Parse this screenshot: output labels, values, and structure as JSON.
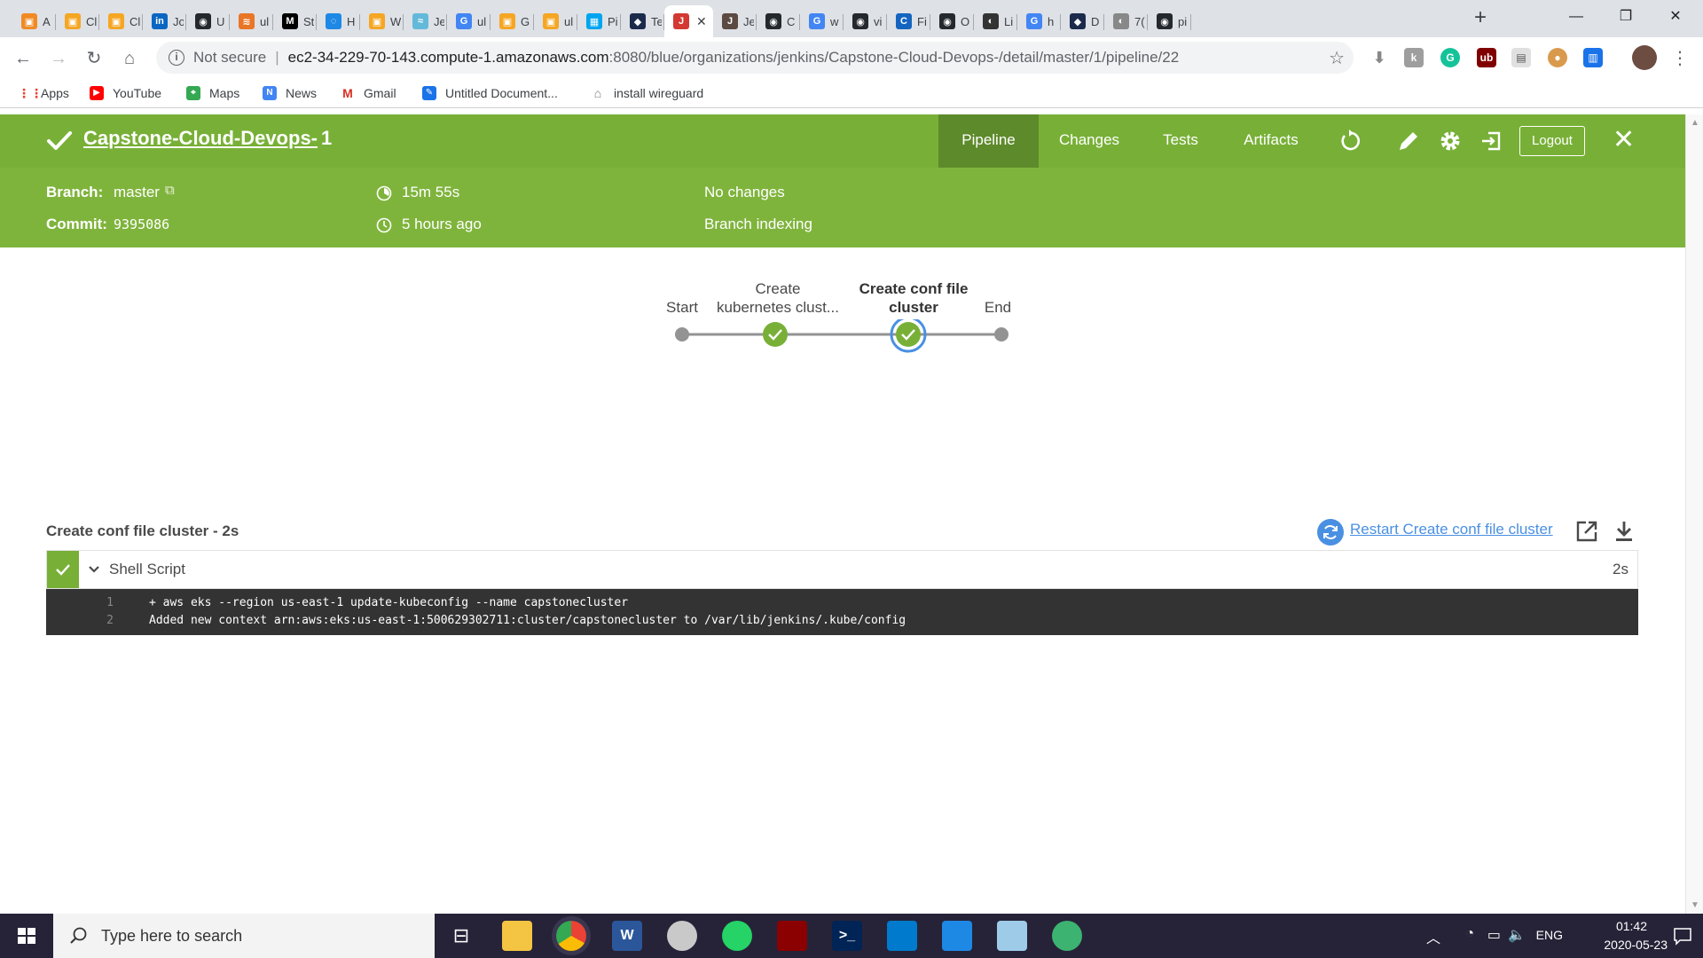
{
  "browser": {
    "tabs": [
      {
        "label": "A",
        "color": "#f08a24",
        "glyph": "▣"
      },
      {
        "label": "Cl",
        "color": "#f5a623",
        "glyph": "▣"
      },
      {
        "label": "Cl",
        "color": "#f5a623",
        "glyph": "▣"
      },
      {
        "label": "Jo",
        "color": "#0a66c2",
        "glyph": "in"
      },
      {
        "label": "U",
        "color": "#24292e",
        "glyph": "◉"
      },
      {
        "label": "ul",
        "color": "#e97627",
        "glyph": "≋"
      },
      {
        "label": "St",
        "color": "#000000",
        "glyph": "M"
      },
      {
        "label": "H",
        "color": "#1e88e5",
        "glyph": "◌"
      },
      {
        "label": "W",
        "color": "#f5a623",
        "glyph": "▣"
      },
      {
        "label": "Je",
        "color": "#63b9d9",
        "glyph": "≈"
      },
      {
        "label": "ul",
        "color": "#4285f4",
        "glyph": "G"
      },
      {
        "label": "G",
        "color": "#f5a623",
        "glyph": "▣"
      },
      {
        "label": "ul",
        "color": "#f5a623",
        "glyph": "▣"
      },
      {
        "label": "Pi",
        "color": "#00a4ef",
        "glyph": "▦"
      },
      {
        "label": "Te",
        "color": "#1c2b4b",
        "glyph": "◆"
      },
      {
        "label": "",
        "color": "#d33833",
        "glyph": "J",
        "active": true
      },
      {
        "label": "Je",
        "color": "#5a4a42",
        "glyph": "J"
      },
      {
        "label": "C",
        "color": "#24292e",
        "glyph": "◉"
      },
      {
        "label": "w",
        "color": "#4285f4",
        "glyph": "G"
      },
      {
        "label": "vi",
        "color": "#24292e",
        "glyph": "◉"
      },
      {
        "label": "Fi",
        "color": "#1565c0",
        "glyph": "C"
      },
      {
        "label": "O",
        "color": "#24292e",
        "glyph": "◉"
      },
      {
        "label": "Li",
        "color": "#333333",
        "glyph": "◐"
      },
      {
        "label": "h",
        "color": "#4285f4",
        "glyph": "G"
      },
      {
        "label": "D",
        "color": "#1c2b4b",
        "glyph": "◆"
      },
      {
        "label": "7(",
        "color": "#888888",
        "glyph": "◐"
      },
      {
        "label": "pi",
        "color": "#24292e",
        "glyph": "◉"
      }
    ],
    "active_tab_close": "✕",
    "new_tab": "+",
    "window": {
      "minimize": "—",
      "maximize": "❐",
      "close": "✕"
    },
    "security_label": "Not secure",
    "url_host": "ec2-34-229-70-143.compute-1.amazonaws.com",
    "url_path": ":8080/blue/organizations/jenkins/Capstone-Cloud-Devops-/detail/master/1/pipeline/22",
    "bookmarks": [
      {
        "label": "Apps",
        "color": "#ea4335",
        "glyph": "⋮"
      },
      {
        "label": "YouTube",
        "color": "#ff0000",
        "glyph": "▶"
      },
      {
        "label": "Maps",
        "color": "#34a853",
        "glyph": "⌖"
      },
      {
        "label": "News",
        "color": "#4285f4",
        "glyph": "N"
      },
      {
        "label": "Gmail",
        "color": "#d93025",
        "glyph": "M"
      },
      {
        "label": "Untitled Document...",
        "color": "#1a73e8",
        "glyph": "✎"
      },
      {
        "label": "install wireguard",
        "color": "#777777",
        "glyph": "⌂"
      }
    ]
  },
  "jenkins": {
    "run_name": "Capstone-Cloud-Devops-",
    "run_number": "1",
    "tabs": [
      "Pipeline",
      "Changes",
      "Tests",
      "Artifacts"
    ],
    "active_tab": "Pipeline",
    "logout_label": "Logout",
    "branch_label": "Branch:",
    "branch_value": "master",
    "commit_label": "Commit:",
    "commit_value": "9395086",
    "duration": "15m 55s",
    "started": "5 hours ago",
    "changes": "No changes",
    "cause": "Branch indexing",
    "colors": {
      "header": "#78b037",
      "subheader": "#7fb43c",
      "success": "#78b037",
      "link": "#4a90e2"
    },
    "pipeline": {
      "stages": [
        {
          "name": "Start",
          "status": "none"
        },
        {
          "name": "Create kubernetes clust...",
          "status": "success"
        },
        {
          "name": "Create conf file cluster",
          "status": "success",
          "selected": true
        },
        {
          "name": "End",
          "status": "none"
        }
      ],
      "labels": {
        "start": "Start",
        "stage1_line1": "Create",
        "stage1_line2": "kubernetes clust...",
        "stage2_line1": "Create conf file",
        "stage2_line2": "cluster",
        "end": "End"
      }
    },
    "step_detail": {
      "title": "Create conf file cluster - 2s",
      "restart_label": "Restart Create conf file cluster",
      "step_name": "Shell Script",
      "step_duration": "2s",
      "log": [
        {
          "n": "1",
          "text": "+ aws eks --region us-east-1 update-kubeconfig --name capstonecluster"
        },
        {
          "n": "2",
          "text": "Added new context arn:aws:eks:us-east-1:500629302711:cluster/capstonecluster to /var/lib/jenkins/.kube/config"
        }
      ]
    }
  },
  "taskbar": {
    "search_placeholder": "Type here to search",
    "language": "ENG",
    "time": "01:42",
    "date": "2020-05-23"
  }
}
